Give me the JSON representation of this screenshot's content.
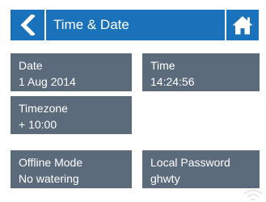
{
  "header": {
    "title": "Time & Date",
    "back_icon": "chevron-left-icon",
    "home_icon": "home-icon"
  },
  "fields": {
    "date": {
      "label": "Date",
      "value": "1 Aug 2014"
    },
    "time": {
      "label": "Time",
      "value": "14:24:56"
    },
    "timezone": {
      "label": "Timezone",
      "value": "+ 10:00"
    },
    "offline_mode": {
      "label": "Offline Mode",
      "value": "No watering"
    },
    "local_password": {
      "label": "Local Password",
      "value": "ghwty"
    }
  },
  "colors": {
    "header_blue": "#1a73ba",
    "field_gray": "#5b6b7b",
    "text": "#ffffff"
  }
}
